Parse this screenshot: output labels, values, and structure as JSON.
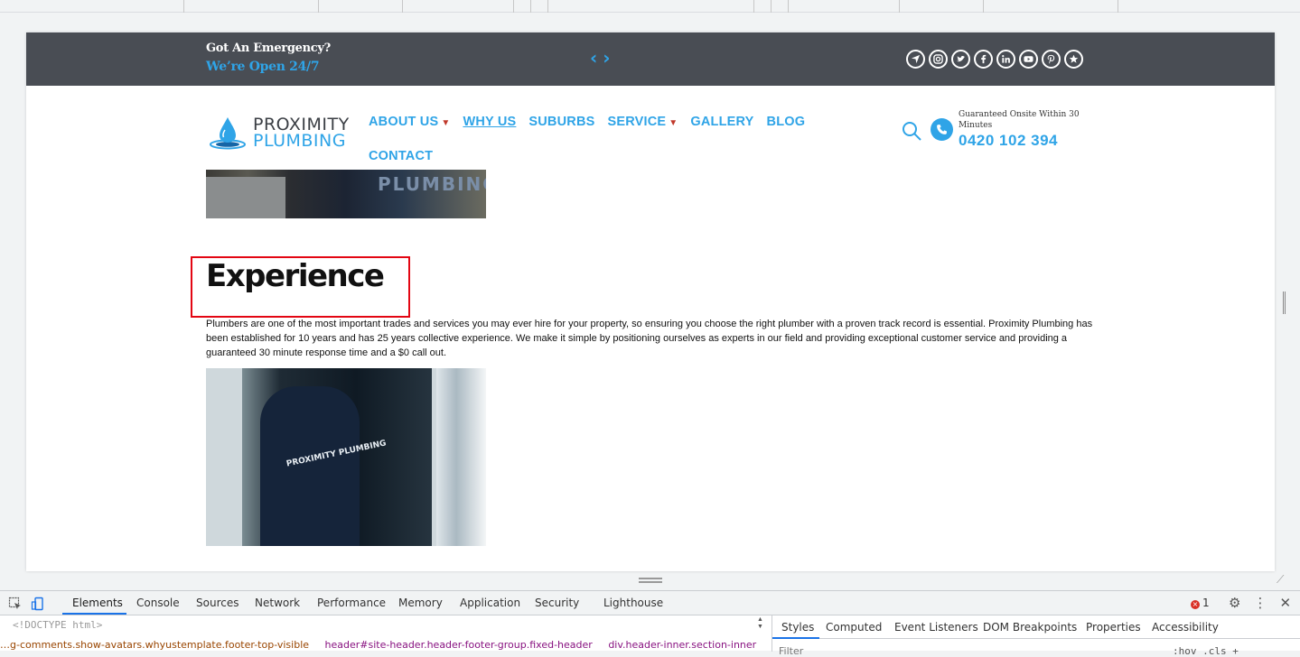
{
  "site": {
    "emergency_line1": "Got An Emergency?",
    "emergency_line2": "We’re Open 24/7",
    "prev_arrow": "‹",
    "next_arrow": "›",
    "socials": [
      "location-icon",
      "instagram-icon",
      "twitter-icon",
      "facebook-icon",
      "linkedin-icon",
      "youtube-icon",
      "pinterest-icon",
      "star-icon"
    ],
    "logo_line1": "PROXIMITY",
    "logo_line2": "PLUMBING",
    "nav": [
      {
        "label": "ABOUT US",
        "dropdown": true,
        "current": false
      },
      {
        "label": "WHY US",
        "dropdown": false,
        "current": true
      },
      {
        "label": "SUBURBS",
        "dropdown": false,
        "current": false
      },
      {
        "label": "SERVICE",
        "dropdown": true,
        "current": false
      },
      {
        "label": "GALLERY",
        "dropdown": false,
        "current": false
      },
      {
        "label": "BLOG",
        "dropdown": false,
        "current": false
      },
      {
        "label": "CONTACT",
        "dropdown": false,
        "current": false
      }
    ],
    "guarantee": "Guaranteed Onsite Within 30 Minutes",
    "phone": "0420 102 394",
    "hero_text": "PLUMBING",
    "heading": "Experience",
    "paragraph": "Plumbers are one of the most important trades and services you may ever hire for your property, so ensuring you choose the right plumber with a proven track record is essential. Proximity Plumbing has been established for 10 years and has 25 years collective experience. We make it simple by positioning ourselves as experts in our field and providing exceptional customer service and providing a guaranteed 30 minute response time and a $0 call out.",
    "shirt_text": "PROXIMITY PLUMBING"
  },
  "devtools": {
    "tabs": [
      "Elements",
      "Console",
      "Sources",
      "Network",
      "Performance",
      "Memory",
      "Application",
      "Security",
      "Lighthouse"
    ],
    "active_tab": "Elements",
    "error_count": "1",
    "doctype": "<!DOCTYPE html>",
    "breadcrumb": [
      {
        "text": "…g-comments.show-avatars.whyustemplate.footer-top-visible"
      },
      {
        "text": "header#site-header.header-footer-group.fixed-header"
      },
      {
        "text": "div.header-inner.section-inner"
      }
    ],
    "more_crumbs": "…",
    "styles_tabs": [
      "Styles",
      "Computed",
      "Event Listeners",
      "DOM Breakpoints",
      "Properties",
      "Accessibility"
    ],
    "filter_placeholder": "Filter",
    "filter_right": ":hov  .cls  +"
  },
  "colors": {
    "accent": "#2fa4e7",
    "top_bar": "#494d54",
    "highlight": "#e30613"
  }
}
